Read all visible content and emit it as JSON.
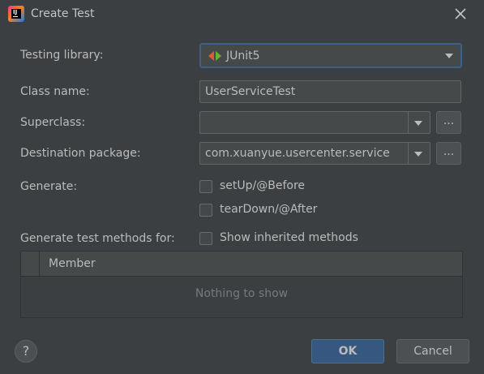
{
  "window": {
    "title": "Create Test"
  },
  "form": {
    "testing_library_label": "Testing library:",
    "testing_library_value": "JUnit5",
    "class_name_label": "Class name:",
    "class_name_value": "UserServiceTest",
    "superclass_label": "Superclass:",
    "superclass_value": "",
    "destination_package_label": "Destination package:",
    "destination_package_value": "com.xuanyue.usercenter.service",
    "browse_label": "...",
    "generate_label": "Generate:",
    "setup_label": "setUp/@Before",
    "setup_checked": false,
    "teardown_label": "tearDown/@After",
    "teardown_checked": false,
    "generate_methods_label": "Generate test methods for:",
    "show_inherited_label": "Show inherited methods",
    "show_inherited_checked": false
  },
  "members_table": {
    "column_member": "Member",
    "empty_text": "Nothing to show"
  },
  "footer": {
    "help_label": "?",
    "ok_label": "OK",
    "cancel_label": "Cancel"
  },
  "icons": {
    "app": "intellij-idea-icon",
    "close": "close-icon",
    "junit": "junit5-icon",
    "dropdown": "chevron-down-icon",
    "help": "help-icon"
  },
  "colors": {
    "background": "#3c3f41",
    "field_background": "#45494a",
    "focus_border": "#3d6185",
    "primary_button": "#365880",
    "junit_red": "#e05a3a",
    "junit_green": "#5fb832"
  }
}
